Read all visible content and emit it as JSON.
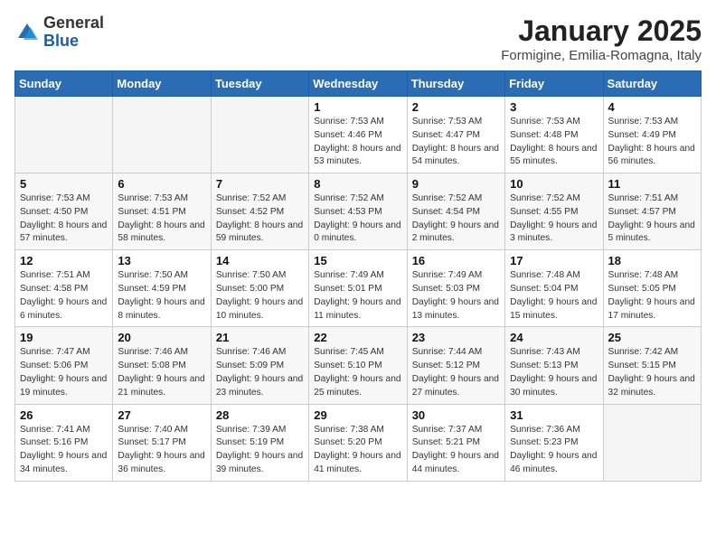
{
  "header": {
    "logo_general": "General",
    "logo_blue": "Blue",
    "title": "January 2025",
    "subtitle": "Formigine, Emilia-Romagna, Italy"
  },
  "weekdays": [
    "Sunday",
    "Monday",
    "Tuesday",
    "Wednesday",
    "Thursday",
    "Friday",
    "Saturday"
  ],
  "weeks": [
    [
      {
        "day": "",
        "info": ""
      },
      {
        "day": "",
        "info": ""
      },
      {
        "day": "",
        "info": ""
      },
      {
        "day": "1",
        "info": "Sunrise: 7:53 AM\nSunset: 4:46 PM\nDaylight: 8 hours and 53 minutes."
      },
      {
        "day": "2",
        "info": "Sunrise: 7:53 AM\nSunset: 4:47 PM\nDaylight: 8 hours and 54 minutes."
      },
      {
        "day": "3",
        "info": "Sunrise: 7:53 AM\nSunset: 4:48 PM\nDaylight: 8 hours and 55 minutes."
      },
      {
        "day": "4",
        "info": "Sunrise: 7:53 AM\nSunset: 4:49 PM\nDaylight: 8 hours and 56 minutes."
      }
    ],
    [
      {
        "day": "5",
        "info": "Sunrise: 7:53 AM\nSunset: 4:50 PM\nDaylight: 8 hours and 57 minutes."
      },
      {
        "day": "6",
        "info": "Sunrise: 7:53 AM\nSunset: 4:51 PM\nDaylight: 8 hours and 58 minutes."
      },
      {
        "day": "7",
        "info": "Sunrise: 7:52 AM\nSunset: 4:52 PM\nDaylight: 8 hours and 59 minutes."
      },
      {
        "day": "8",
        "info": "Sunrise: 7:52 AM\nSunset: 4:53 PM\nDaylight: 9 hours and 0 minutes."
      },
      {
        "day": "9",
        "info": "Sunrise: 7:52 AM\nSunset: 4:54 PM\nDaylight: 9 hours and 2 minutes."
      },
      {
        "day": "10",
        "info": "Sunrise: 7:52 AM\nSunset: 4:55 PM\nDaylight: 9 hours and 3 minutes."
      },
      {
        "day": "11",
        "info": "Sunrise: 7:51 AM\nSunset: 4:57 PM\nDaylight: 9 hours and 5 minutes."
      }
    ],
    [
      {
        "day": "12",
        "info": "Sunrise: 7:51 AM\nSunset: 4:58 PM\nDaylight: 9 hours and 6 minutes."
      },
      {
        "day": "13",
        "info": "Sunrise: 7:50 AM\nSunset: 4:59 PM\nDaylight: 9 hours and 8 minutes."
      },
      {
        "day": "14",
        "info": "Sunrise: 7:50 AM\nSunset: 5:00 PM\nDaylight: 9 hours and 10 minutes."
      },
      {
        "day": "15",
        "info": "Sunrise: 7:49 AM\nSunset: 5:01 PM\nDaylight: 9 hours and 11 minutes."
      },
      {
        "day": "16",
        "info": "Sunrise: 7:49 AM\nSunset: 5:03 PM\nDaylight: 9 hours and 13 minutes."
      },
      {
        "day": "17",
        "info": "Sunrise: 7:48 AM\nSunset: 5:04 PM\nDaylight: 9 hours and 15 minutes."
      },
      {
        "day": "18",
        "info": "Sunrise: 7:48 AM\nSunset: 5:05 PM\nDaylight: 9 hours and 17 minutes."
      }
    ],
    [
      {
        "day": "19",
        "info": "Sunrise: 7:47 AM\nSunset: 5:06 PM\nDaylight: 9 hours and 19 minutes."
      },
      {
        "day": "20",
        "info": "Sunrise: 7:46 AM\nSunset: 5:08 PM\nDaylight: 9 hours and 21 minutes."
      },
      {
        "day": "21",
        "info": "Sunrise: 7:46 AM\nSunset: 5:09 PM\nDaylight: 9 hours and 23 minutes."
      },
      {
        "day": "22",
        "info": "Sunrise: 7:45 AM\nSunset: 5:10 PM\nDaylight: 9 hours and 25 minutes."
      },
      {
        "day": "23",
        "info": "Sunrise: 7:44 AM\nSunset: 5:12 PM\nDaylight: 9 hours and 27 minutes."
      },
      {
        "day": "24",
        "info": "Sunrise: 7:43 AM\nSunset: 5:13 PM\nDaylight: 9 hours and 30 minutes."
      },
      {
        "day": "25",
        "info": "Sunrise: 7:42 AM\nSunset: 5:15 PM\nDaylight: 9 hours and 32 minutes."
      }
    ],
    [
      {
        "day": "26",
        "info": "Sunrise: 7:41 AM\nSunset: 5:16 PM\nDaylight: 9 hours and 34 minutes."
      },
      {
        "day": "27",
        "info": "Sunrise: 7:40 AM\nSunset: 5:17 PM\nDaylight: 9 hours and 36 minutes."
      },
      {
        "day": "28",
        "info": "Sunrise: 7:39 AM\nSunset: 5:19 PM\nDaylight: 9 hours and 39 minutes."
      },
      {
        "day": "29",
        "info": "Sunrise: 7:38 AM\nSunset: 5:20 PM\nDaylight: 9 hours and 41 minutes."
      },
      {
        "day": "30",
        "info": "Sunrise: 7:37 AM\nSunset: 5:21 PM\nDaylight: 9 hours and 44 minutes."
      },
      {
        "day": "31",
        "info": "Sunrise: 7:36 AM\nSunset: 5:23 PM\nDaylight: 9 hours and 46 minutes."
      },
      {
        "day": "",
        "info": ""
      }
    ]
  ]
}
